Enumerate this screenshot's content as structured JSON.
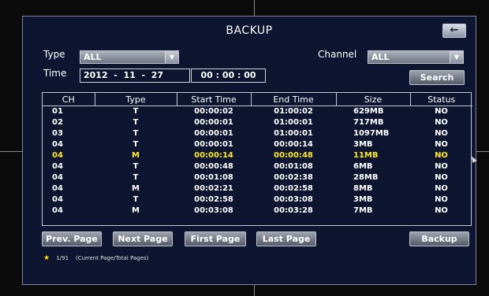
{
  "dialog": {
    "title": "BACKUP",
    "back_icon": "←"
  },
  "filters": {
    "type_label": "Type",
    "type_value": "ALL",
    "channel_label": "Channel",
    "channel_value": "ALL",
    "time_label": "Time",
    "date_year": "2012",
    "date_month": "11",
    "date_day": "27",
    "time_value": "00 : 00 : 00",
    "search_label": "Search"
  },
  "table": {
    "headers": [
      "CH",
      "Type",
      "Start Time",
      "End Time",
      "Size",
      "Status"
    ],
    "rows": [
      [
        "01",
        "T",
        "00:00:02",
        "01:00:02",
        "629MB",
        "NO"
      ],
      [
        "02",
        "T",
        "00:00:01",
        "01:00:01",
        "717MB",
        "NO"
      ],
      [
        "03",
        "T",
        "00:00:01",
        "01:00:01",
        "1097MB",
        "NO"
      ],
      [
        "04",
        "T",
        "00:00:01",
        "00:00:14",
        "3MB",
        "NO"
      ],
      [
        "04",
        "M",
        "00:00:14",
        "00:00:48",
        "11MB",
        "NO"
      ],
      [
        "04",
        "T",
        "00:00:48",
        "00:01:08",
        "6MB",
        "NO"
      ],
      [
        "04",
        "T",
        "00:01:08",
        "00:02:38",
        "28MB",
        "NO"
      ],
      [
        "04",
        "M",
        "00:02:21",
        "00:02:58",
        "8MB",
        "NO"
      ],
      [
        "04",
        "T",
        "00:02:58",
        "00:03:08",
        "3MB",
        "NO"
      ],
      [
        "04",
        "M",
        "00:03:08",
        "00:03:28",
        "7MB",
        "NO"
      ]
    ],
    "highlight_row": 4,
    "highlight_color": "#ffea2a"
  },
  "buttons": {
    "prev_page": "Prev. Page",
    "next_page": "Next Page",
    "first_page": "First Page",
    "last_page": "Last Page",
    "backup": "Backup"
  },
  "footer": {
    "page_info": "1/91",
    "page_hint": "(Current Page/Total Pages)",
    "star_icon": "★"
  }
}
